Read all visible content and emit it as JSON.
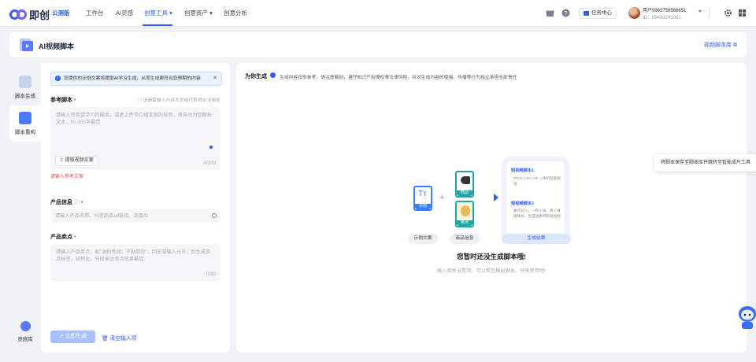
{
  "app": {
    "logo_text": "即创"
  },
  "nav": {
    "items": [
      {
        "label": "公测版"
      },
      {
        "label": "工作台"
      },
      {
        "label": "AI灵感"
      },
      {
        "label": "创意工具 ▾"
      },
      {
        "label": "创意资产 ▾"
      },
      {
        "label": "创意分析"
      }
    ],
    "task_center": "任务中心",
    "user_name": "用户9962758568651",
    "user_id": "ID：99433241002"
  },
  "page": {
    "title": "AI视频脚本",
    "library_link": "视频脚本库 ⧉"
  },
  "rail": [
    {
      "label": "脚本生成"
    },
    {
      "label": "脚本重构"
    },
    {
      "label": "灵感库"
    }
  ],
  "form": {
    "notice": "您提供的示例文案将提取AI学习生成，从而生成更符合您预期的内容",
    "ref_label": "参考脚本",
    "ref_hint": "ⓘ 请确保输入内容为您或已取得合法授权",
    "ref_placeholder": "请输入您希望学习的脚本，或者上传带口播文案的视频，将自动为您解析文本，50-300字最佳",
    "extract_label": "提取视频文案",
    "ref_count": "0/300",
    "ref_error": "请输入参考文案",
    "product_label": "产品信息",
    "product_placeholder": "请输入产品名称、抖音商品url链接、商品ID",
    "selling_label": "产品卖点",
    "selling_placeholder": "请输入产品卖点，如\"油和亮润；不黏腻你\"，回车或输入分号；后生成卖点标签，结构化，分段表达卖点效果最佳",
    "selling_count": "0/80",
    "generate_label": "立即生成",
    "clear_label": "清空输入项"
  },
  "result": {
    "title": "为你生成",
    "note": "生成内容仅供参考，请注意甄别，遵守知识产权侵权等法律风险，并对生成内容的使用、传播等行为独立承担全部责任",
    "tile_example": "示例",
    "tile_product": "商品",
    "tile_selling": "卖点",
    "pill_example": "示例文案",
    "pill_product": "商品信息",
    "pill_result": "生成结果",
    "script1_title": "短视频脚本1",
    "script1_body": "PICO 4 Pro VR 一体机智能眼镜",
    "script2_title": "短视频脚本2",
    "script2_body": "痛点切入，一秒入局，真人真情体验，生成优质带货短视频",
    "empty_title": "您暂时还没生成脚本哦!",
    "empty_sub": "输入相关设置项，可以帮您输出脚本，快来使用吧!"
  },
  "tooltip": "将脚本保存至脚本库并跳转至智能成片工具",
  "colors": {
    "primary": "#2f5bff",
    "error": "#e5484d"
  }
}
